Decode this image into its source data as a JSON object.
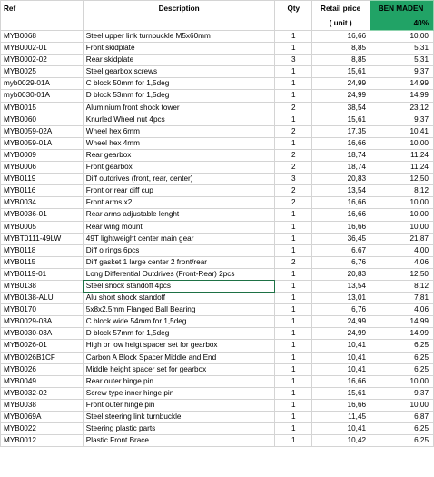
{
  "header": {
    "ref": "Ref",
    "description": "Description",
    "qty": "Qty",
    "retail_price": "Retail price",
    "retail_unit": "( unit )",
    "ben_maden": "BEN MADEN",
    "ben_maden_pct": "40%"
  },
  "accent_color": "#21a366",
  "rows": [
    {
      "ref": "MYB0068",
      "desc": "Steel upper link turnbuckle M5x60mm",
      "qty": "1",
      "price": "16,66",
      "bm": "10,00"
    },
    {
      "ref": "MYB0002-01",
      "desc": "Front skidplate",
      "qty": "1",
      "price": "8,85",
      "bm": "5,31"
    },
    {
      "ref": "MYB0002-02",
      "desc": "Rear skidplate",
      "qty": "3",
      "price": "8,85",
      "bm": "5,31"
    },
    {
      "ref": "MYB0025",
      "desc": "Steel gearbox screws",
      "qty": "1",
      "price": "15,61",
      "bm": "9,37"
    },
    {
      "ref": "myb0029-01A",
      "desc": "C block 50mm for 1,5deg",
      "qty": "1",
      "price": "24,99",
      "bm": "14,99"
    },
    {
      "ref": "myb0030-01A",
      "desc": "D block 53mm for 1,5deg",
      "qty": "1",
      "price": "24,99",
      "bm": "14,99"
    },
    {
      "ref": "MYB0015",
      "desc": "Aluminium front shock tower",
      "qty": "2",
      "price": "38,54",
      "bm": "23,12"
    },
    {
      "ref": "MYB0060",
      "desc": "Knurled Wheel nut 4pcs",
      "qty": "1",
      "price": "15,61",
      "bm": "9,37"
    },
    {
      "ref": "MYB0059-02A",
      "desc": "Wheel hex 6mm",
      "qty": "2",
      "price": "17,35",
      "bm": "10,41"
    },
    {
      "ref": "MYB0059-01A",
      "desc": "Wheel hex 4mm",
      "qty": "1",
      "price": "16,66",
      "bm": "10,00"
    },
    {
      "ref": "MYB0009",
      "desc": "Rear gearbox",
      "qty": "2",
      "price": "18,74",
      "bm": "11,24"
    },
    {
      "ref": "MYB0006",
      "desc": "Front gearbox",
      "qty": "2",
      "price": "18,74",
      "bm": "11,24"
    },
    {
      "ref": "MYB0119",
      "desc": "Diff outdrives (front, rear, center)",
      "qty": "3",
      "price": "20,83",
      "bm": "12,50"
    },
    {
      "ref": "MYB0116",
      "desc": "Front or rear diff cup",
      "qty": "2",
      "price": "13,54",
      "bm": "8,12"
    },
    {
      "ref": "MYB0034",
      "desc": "Front arms x2",
      "qty": "2",
      "price": "16,66",
      "bm": "10,00"
    },
    {
      "ref": "MYB0036-01",
      "desc": "Rear arms adjustable lenght",
      "qty": "1",
      "price": "16,66",
      "bm": "10,00"
    },
    {
      "ref": "MYB0005",
      "desc": "Rear wing mount",
      "qty": "1",
      "price": "16,66",
      "bm": "10,00"
    },
    {
      "ref": "MYBT0111-49LW",
      "desc": "49T lightweight center main gear",
      "qty": "1",
      "price": "36,45",
      "bm": "21,87"
    },
    {
      "ref": "MYB0118",
      "desc": "Diff o rings 6pcs",
      "qty": "1",
      "price": "6,67",
      "bm": "4,00"
    },
    {
      "ref": "MYB0115",
      "desc": "Diff gasket 1 large center 2 front/rear",
      "qty": "2",
      "price": "6,76",
      "bm": "4,06"
    },
    {
      "ref": "MYB0119-01",
      "desc": "Long Differential Outdrives (Front-Rear) 2pcs",
      "qty": "1",
      "price": "20,83",
      "bm": "12,50"
    },
    {
      "ref": "MYB0138",
      "desc": "Steel shock standoff 4pcs",
      "qty": "1",
      "price": "13,54",
      "bm": "8,12",
      "selected": true
    },
    {
      "ref": "MYB0138-ALU",
      "desc": "Alu short shock standoff",
      "qty": "1",
      "price": "13,01",
      "bm": "7,81"
    },
    {
      "ref": "MYB0170",
      "desc": "5x8x2.5mm Flanged Ball Bearing",
      "qty": "1",
      "price": "6,76",
      "bm": "4,06"
    },
    {
      "ref": "MYB0029-03A",
      "desc": "C block wide 54mm for 1,5deg",
      "qty": "1",
      "price": "24,99",
      "bm": "14,99"
    },
    {
      "ref": "MYB0030-03A",
      "desc": "D block 57mm for 1,5deg",
      "qty": "1",
      "price": "24,99",
      "bm": "14,99"
    },
    {
      "ref": "MYB0026-01",
      "desc": "High or low heigt spacer set for gearbox",
      "qty": "1",
      "price": "10,41",
      "bm": "6,25"
    },
    {
      "ref": "MYB0026B1CF",
      "desc": "Carbon A Block Spacer Middle and End",
      "qty": "1",
      "price": "10,41",
      "bm": "6,25"
    },
    {
      "ref": "MYB0026",
      "desc": "Middle height spacer set for gearbox",
      "qty": "1",
      "price": "10,41",
      "bm": "6,25"
    },
    {
      "ref": "MYB0049",
      "desc": "Rear outer hinge pin",
      "qty": "1",
      "price": "16,66",
      "bm": "10,00"
    },
    {
      "ref": "MYB0032-02",
      "desc": "Screw type inner hinge pin",
      "qty": "1",
      "price": "15,61",
      "bm": "9,37"
    },
    {
      "ref": "MYB0038",
      "desc": "Front outer hinge pin",
      "qty": "1",
      "price": "16,66",
      "bm": "10,00"
    },
    {
      "ref": "MYB0069A",
      "desc": "Steel steering link turnbuckle",
      "qty": "1",
      "price": "11,45",
      "bm": "6,87"
    },
    {
      "ref": "MYB0022",
      "desc": "Steering plastic parts",
      "qty": "1",
      "price": "10,41",
      "bm": "6,25"
    },
    {
      "ref": "MYB0012",
      "desc": "Plastic Front Brace",
      "qty": "1",
      "price": "10,42",
      "bm": "6,25"
    }
  ]
}
